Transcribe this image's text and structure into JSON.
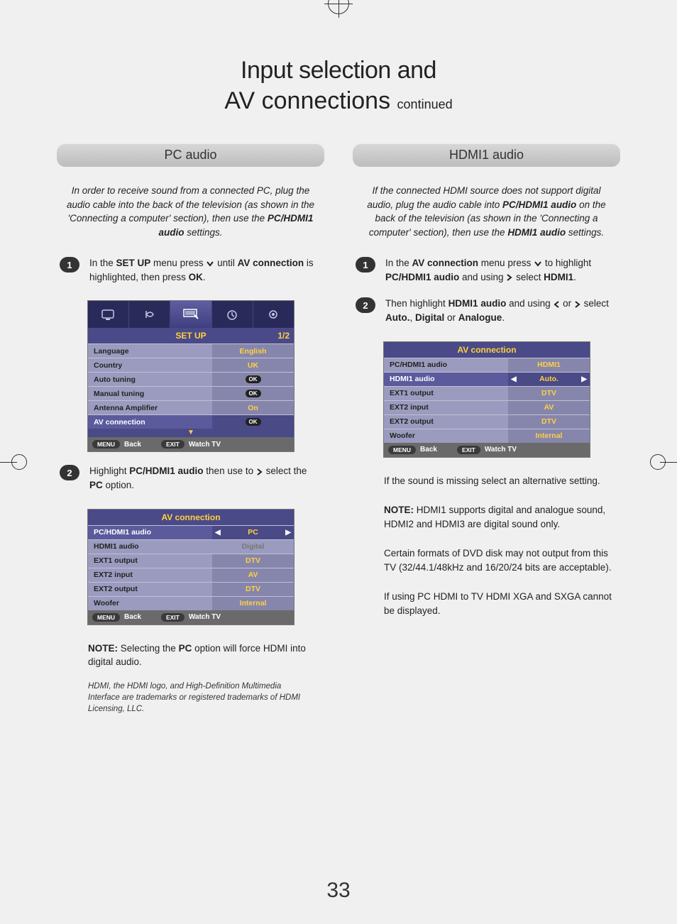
{
  "title_line1": "Input selection and",
  "title_line2_bold": "AV connections",
  "title_line2_small": "continued",
  "page_number": "33",
  "left": {
    "section": "PC audio",
    "intro_parts": [
      "In order to receive sound from a connected PC, plug the audio cable into the back of the television (as shown in the 'Connecting a computer' section), then use the ",
      "PC/HDMI1 audio",
      " settings."
    ],
    "step1_parts": [
      "In the ",
      "SET UP",
      " menu press ",
      "v",
      " until ",
      "AV connection",
      " is highlighted, then press ",
      "OK",
      "."
    ],
    "osd1": {
      "title": "SET UP",
      "page": "1/2",
      "rows": [
        {
          "label": "Language",
          "value": "English"
        },
        {
          "label": "Country",
          "value": "UK"
        },
        {
          "label": "Auto tuning",
          "value": "OK",
          "ok": true
        },
        {
          "label": "Manual tuning",
          "value": "OK",
          "ok": true
        },
        {
          "label": "Antenna Amplifier",
          "value": "On"
        },
        {
          "label": "AV connection",
          "value": "OK",
          "ok": true,
          "highlight": true
        }
      ],
      "footer": {
        "menu": "MENU",
        "back": "Back",
        "exit": "EXIT",
        "watch": "Watch TV"
      }
    },
    "step2_parts": [
      "Highlight ",
      "PC/HDMI1 audio",
      " then use to ",
      ">",
      " select the ",
      "PC",
      " option."
    ],
    "osd2": {
      "title": "AV connection",
      "rows": [
        {
          "label": "PC/HDMI1 audio",
          "value": "PC",
          "highlight": true,
          "arrows": true
        },
        {
          "label": "HDMI1 audio",
          "value": "Digital",
          "dim": true
        },
        {
          "label": "EXT1 output",
          "value": "DTV"
        },
        {
          "label": "EXT2 input",
          "value": "AV"
        },
        {
          "label": "EXT2 output",
          "value": "DTV"
        },
        {
          "label": "Woofer",
          "value": "Internal"
        }
      ],
      "footer": {
        "menu": "MENU",
        "back": "Back",
        "exit": "EXIT",
        "watch": "Watch TV"
      }
    },
    "note_parts": [
      "NOTE:",
      " Selecting the ",
      "PC",
      " option will force HDMI into digital audio."
    ],
    "trademark": "HDMI, the HDMI logo, and High-Definition Multimedia Interface are trademarks or registered trademarks of HDMI Licensing, LLC."
  },
  "right": {
    "section": "HDMI1 audio",
    "intro_parts": [
      "If the connected HDMI source does not support digital audio, plug the audio cable into ",
      "PC/HDMI1 audio",
      " on the back of the television (as shown in the 'Connecting a computer' section), then use the ",
      "HDMI1 audio",
      " settings."
    ],
    "step1_parts": [
      "In the ",
      "AV connection",
      " menu press ",
      "v",
      " to highlight ",
      "PC/HDMI1 audio",
      " and using ",
      ">",
      " select ",
      "HDMI1",
      "."
    ],
    "step2_parts": [
      "Then highlight ",
      "HDMI1 audio",
      " and using ",
      "<",
      " or ",
      ">",
      " select ",
      "Auto.",
      ", ",
      "Digital",
      " or ",
      "Analogue",
      "."
    ],
    "osd": {
      "title": "AV connection",
      "rows": [
        {
          "label": "PC/HDMI1 audio",
          "value": "HDMI1"
        },
        {
          "label": "HDMI1 audio",
          "value": "Auto.",
          "highlight": true,
          "arrows": true
        },
        {
          "label": "EXT1 output",
          "value": "DTV"
        },
        {
          "label": "EXT2 input",
          "value": "AV"
        },
        {
          "label": "EXT2 output",
          "value": "DTV"
        },
        {
          "label": "Woofer",
          "value": "Internal"
        }
      ],
      "footer": {
        "menu": "MENU",
        "back": "Back",
        "exit": "EXIT",
        "watch": "Watch TV"
      }
    },
    "notes": [
      "If the sound is missing select an alternative setting.",
      "NOTE: HDMI1 supports digital and analogue sound, HDMI2 and HDMI3 are digital sound only.",
      "Certain formats of DVD disk may not output from this TV (32/44.1/48kHz and 16/20/24 bits are acceptable).",
      "If using PC HDMI to TV HDMI XGA and SXGA cannot be displayed."
    ]
  }
}
